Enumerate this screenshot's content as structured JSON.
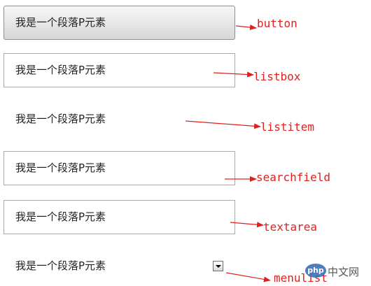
{
  "paragraph_text": "我是一个段落P元素",
  "labels": {
    "button": "button",
    "listbox": "listbox",
    "listitem": "listitem",
    "searchfield": "searchfield",
    "textarea": "textarea",
    "menulist": "menulist"
  },
  "menulist_arrow_icon": "triangle-down",
  "watermark": {
    "logo": "php",
    "text": "中文网"
  },
  "colors": {
    "annotation": "#e0201f",
    "border": "#a9a9a9"
  }
}
